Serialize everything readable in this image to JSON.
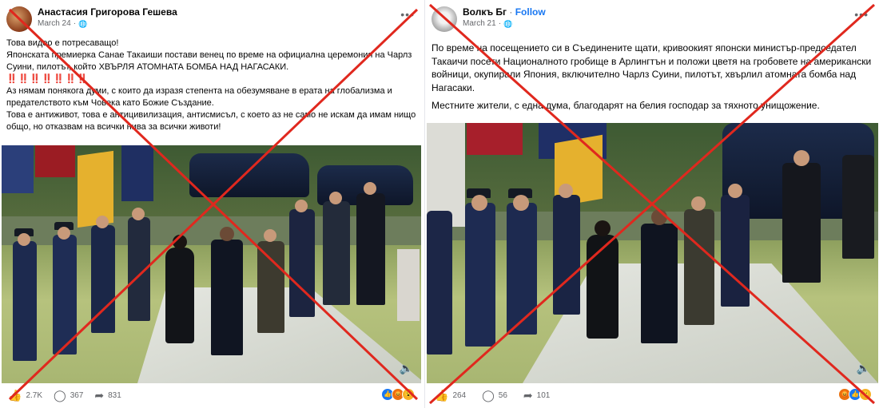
{
  "posts": [
    {
      "author": "Анастасия Григорова Гешева",
      "date": "March 24",
      "privacy_icon": "globe-icon",
      "more_label": "•••",
      "paragraphs": [
        "Това видео е потресаващо!",
        "Японската премиерка Санае Такаиши постави венец по време на официална церемония на Чарлз Суини, пилотът, който ХВЪРЛЯ АТОМНАТА БОМБА НАД НАГАСАКИ.",
        "Аз нямам понякога думи, с които да изразя степента на обезумяване в ерата на глобализма и предателството към Човека като Божие Създание.",
        "Това е антиживот, това е антицивилизация, антисмисъл, с което аз не само не искам да имам нищо общо, но отказвам на всички нива за всички животи!"
      ],
      "exclamations": "‼️‼️‼️‼️‼️‼️‼️",
      "reactions_count": "2.7K",
      "comments_count": "367",
      "shares_count": "831",
      "reaction_icons": [
        "like-icon",
        "angry-icon",
        "wow-icon"
      ]
    },
    {
      "author": "Волкъ Бг",
      "follow_label": "Follow",
      "date": "March 21",
      "privacy_icon": "globe-icon",
      "more_label": "•••",
      "paragraphs": [
        "По време на посещението си в Съединените щати, кривоокият японски министър-председател Такаичи посети Националното гробище в Арлингтън и положи цветя на гробовете на американски войници, окупирали Япония, включително Чарлз Суини, пилотът, хвърлил атомната бомба над Нагасаки.",
        "Местните жители, с една дума, благодарят на белия господар за тяхното унищожение."
      ],
      "reactions_count": "264",
      "comments_count": "56",
      "shares_count": "101",
      "reaction_icons": [
        "angry-icon",
        "like-icon",
        "wow-icon"
      ]
    }
  ],
  "colors": {
    "cross_red": "#e0281e",
    "link_blue": "#1877f2",
    "meta_gray": "#65676b"
  }
}
